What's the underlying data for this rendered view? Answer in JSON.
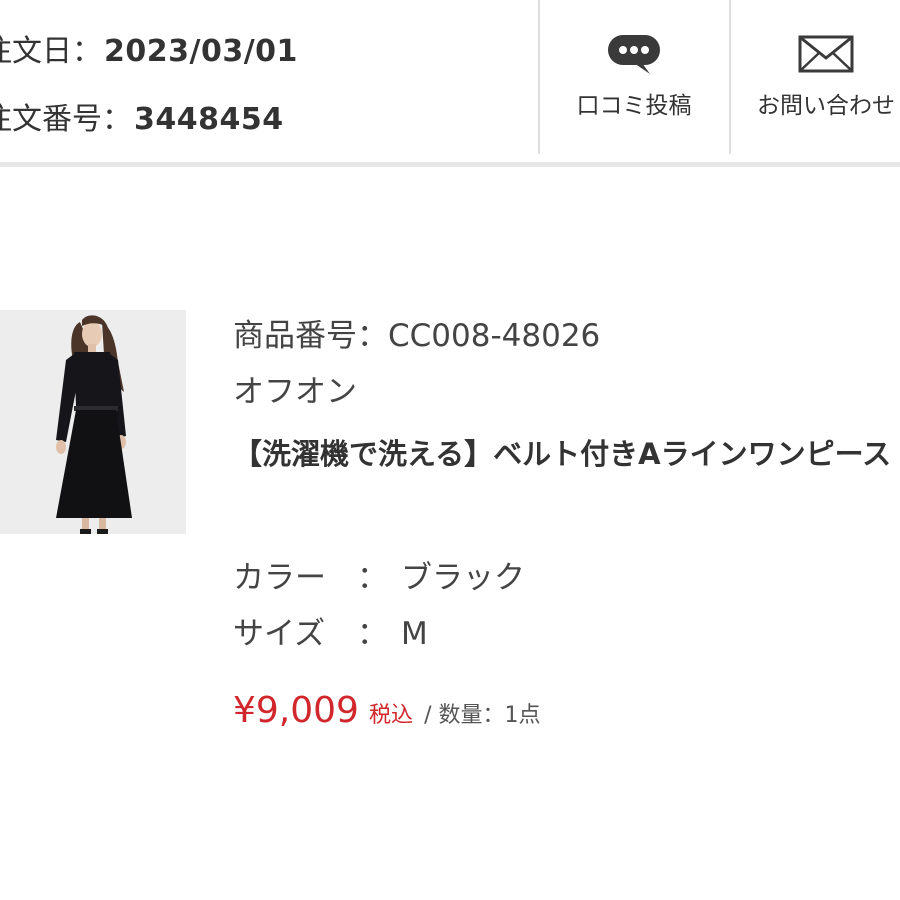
{
  "order": {
    "date_label": "注文日：",
    "date_value": "2023/03/01",
    "number_label": "注文番号：",
    "number_value": "3448454"
  },
  "actions": {
    "review_label": "口コミ投稿",
    "review_icon": "chat-bubble-icon",
    "contact_label": "お問い合わせ",
    "contact_icon": "mail-envelope-icon"
  },
  "product": {
    "code_label": "商品番号：",
    "code_value": "CC008-48026",
    "brand": "オフオン",
    "name": "【洗濯機で洗える】ベルト付きAラインワンピース",
    "color_label": "カラー",
    "color_value": "ブラック",
    "size_label": "サイズ",
    "size_value": "M",
    "separator": "：",
    "price": "¥9,009",
    "tax_label": "税込",
    "quantity_text": "/ 数量：1点"
  },
  "colors": {
    "price_red": "#d1262b",
    "text": "#333333",
    "divider": "#e6e6e6"
  }
}
